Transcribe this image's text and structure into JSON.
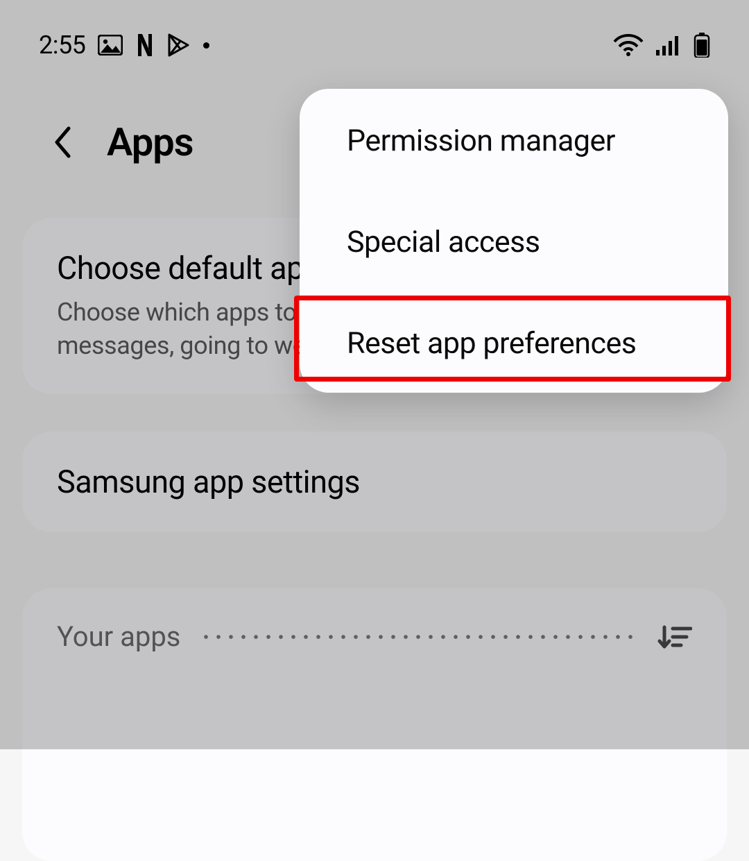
{
  "status_bar": {
    "time": "2:55",
    "icons": {
      "photo": "photo-icon",
      "n": "n-icon",
      "play": "play-icon"
    }
  },
  "header": {
    "title": "Apps"
  },
  "choose_default": {
    "title": "Choose default apps",
    "desc_line1": "Choose which apps to use for making calls, sending",
    "desc_line2": "messages, going to websites, and more."
  },
  "samsung_app_settings": {
    "label": "Samsung app settings"
  },
  "your_apps": {
    "label": "Your apps"
  },
  "menu": {
    "items": [
      {
        "label": "Permission manager"
      },
      {
        "label": "Special access"
      },
      {
        "label": "Reset app preferences"
      }
    ]
  }
}
